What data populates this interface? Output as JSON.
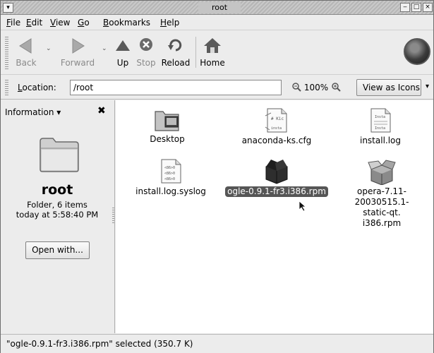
{
  "window": {
    "title": "root"
  },
  "menu": [
    {
      "first": "F",
      "rest": "ile"
    },
    {
      "first": "E",
      "rest": "dit"
    },
    {
      "first": "V",
      "rest": "iew"
    },
    {
      "first": "G",
      "rest": "o"
    },
    {
      "first": "B",
      "rest": "ookmarks"
    },
    {
      "first": "H",
      "rest": "elp"
    }
  ],
  "toolbar": {
    "back": "Back",
    "forward": "Forward",
    "up": "Up",
    "stop": "Stop",
    "reload": "Reload",
    "home": "Home"
  },
  "location": {
    "label_first": "L",
    "label_rest": "ocation:",
    "value": "/root",
    "zoom": "100%",
    "view_as": "View as Icons"
  },
  "sidebar": {
    "header": "Information",
    "name": "root",
    "type": "Folder, 6 items",
    "modified": "today at 5:58:40 PM",
    "open_with": "Open with..."
  },
  "files": [
    {
      "label": "Desktop",
      "icon": "desktop-folder-icon"
    },
    {
      "label": "anaconda-ks.cfg",
      "icon": "config-file-icon"
    },
    {
      "label": "install.log",
      "icon": "log-file-icon"
    },
    {
      "label": "install.log.syslog",
      "icon": "log-file-icon"
    },
    {
      "label": "ogle-0.9.1-fr3.i386.rpm",
      "icon": "rpm-package-icon",
      "selected": true
    },
    {
      "label_lines": [
        "opera-7.11-",
        "20030515.1-static-qt.",
        "i386.rpm"
      ],
      "icon": "rpm-package-open-icon"
    }
  ],
  "status": "\"ogle-0.9.1-fr3.i386.rpm\" selected (350.7 K)",
  "colors": {
    "selection": "#565656",
    "window_bg": "#ececec",
    "view_bg": "#ffffff"
  }
}
